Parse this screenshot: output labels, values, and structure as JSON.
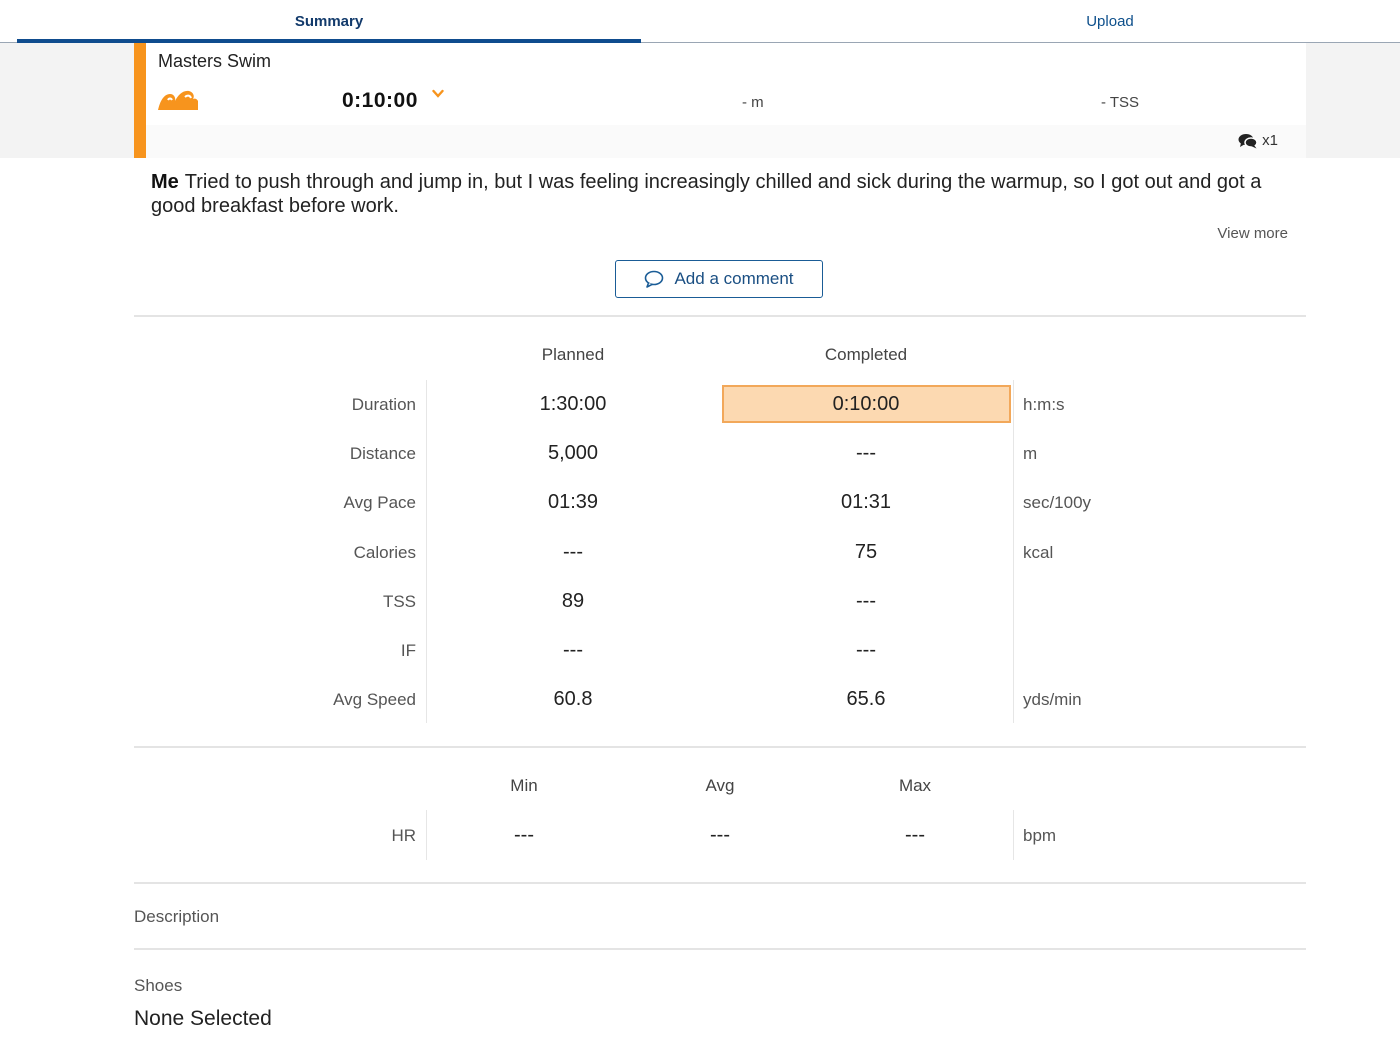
{
  "tabs": {
    "summary": "Summary",
    "upload": "Upload"
  },
  "workout": {
    "title": "Masters Swim",
    "duration": "0:10:00",
    "distance": "- m",
    "tss": "- TSS",
    "comment_count": "x1",
    "accent_color": "#f7941d"
  },
  "comment": {
    "author": "Me",
    "text": "Tried to push through and jump in, but I was feeling increasingly chilled and sick during the warmup, so I got out and got a good breakfast before work.",
    "view_more": "View more",
    "add_label": "Add a comment"
  },
  "stats": {
    "headers": {
      "planned": "Planned",
      "completed": "Completed"
    },
    "rows": [
      {
        "label": "Duration",
        "planned": "1:30:00",
        "completed": "0:10:00",
        "unit": "h:m:s"
      },
      {
        "label": "Distance",
        "planned": "5,000",
        "completed": "---",
        "unit": "m"
      },
      {
        "label": "Avg Pace",
        "planned": "01:39",
        "completed": "01:31",
        "unit": "sec/100y"
      },
      {
        "label": "Calories",
        "planned": "---",
        "completed": "75",
        "unit": "kcal"
      },
      {
        "label": "TSS",
        "planned": "89",
        "completed": "---",
        "unit": ""
      },
      {
        "label": "IF",
        "planned": "---",
        "completed": "---",
        "unit": ""
      },
      {
        "label": "Avg Speed",
        "planned": "60.8",
        "completed": "65.6",
        "unit": "yds/min"
      }
    ]
  },
  "hr": {
    "headers": {
      "min": "Min",
      "avg": "Avg",
      "max": "Max"
    },
    "label": "HR",
    "min": "---",
    "avg": "---",
    "max": "---",
    "unit": "bpm"
  },
  "description": {
    "label": "Description"
  },
  "shoes": {
    "label": "Shoes",
    "value": "None Selected"
  }
}
